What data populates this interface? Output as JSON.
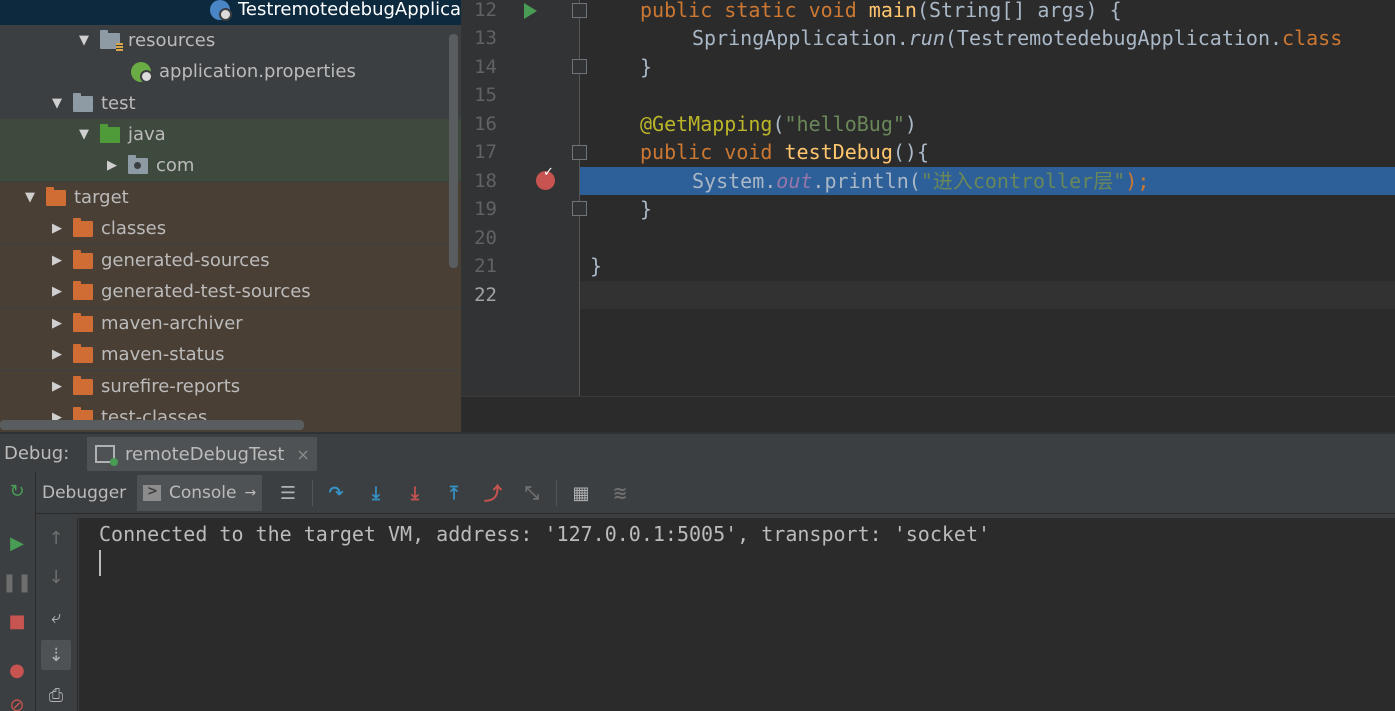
{
  "project_tree": {
    "items": [
      {
        "label": "TestremotedebugApplica"
      },
      {
        "label": "resources"
      },
      {
        "label": "application.properties"
      },
      {
        "label": "test"
      },
      {
        "label": "java"
      },
      {
        "label": "com"
      },
      {
        "label": "target"
      },
      {
        "label": "classes"
      },
      {
        "label": "generated-sources"
      },
      {
        "label": "generated-test-sources"
      },
      {
        "label": "maven-archiver"
      },
      {
        "label": "maven-status"
      },
      {
        "label": "surefire-reports"
      },
      {
        "label": "test-classes"
      }
    ]
  },
  "editor": {
    "line_numbers": [
      "12",
      "13",
      "14",
      "15",
      "16",
      "17",
      "18",
      "19",
      "20",
      "21",
      "22"
    ],
    "code": {
      "l12_kw": "public static void ",
      "l12_fn": "main",
      "l12_rest": "(String[] args) {",
      "l13_a": "SpringApplication.",
      "l13_run": "run",
      "l13_b": "(TestremotedebugApplication.",
      "l13_class": "class",
      "l14": "}",
      "l16_ann": "@GetMapping",
      "l16_open": "(",
      "l16_str": "\"helloBug\"",
      "l16_close": ")",
      "l17_kw": "public void ",
      "l17_fn": "testDebug",
      "l17_rest": "(){",
      "l18_a": "System.",
      "l18_out": "out",
      "l18_b": ".println(",
      "l18_str": "\"进入controller层\"",
      "l18_c": ");",
      "l19": "}",
      "l21": "}"
    },
    "colors": {
      "keyword": "#cc7832",
      "method": "#ffc66d",
      "string": "#6a8759",
      "annotation": "#bbb529",
      "highlight": "#2d6099"
    }
  },
  "debug": {
    "title": "Debug:",
    "tab_label": "remoteDebugTest",
    "tab_close": "×",
    "debugger_tab": "Debugger",
    "console_tab": "Console",
    "console_output": "Connected to the target VM, address: '127.0.0.1:5005', transport: 'socket'"
  }
}
